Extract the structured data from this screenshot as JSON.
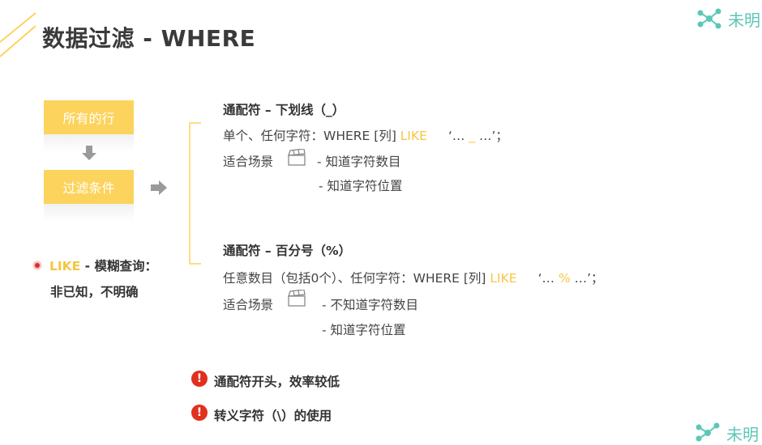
{
  "title": "数据过滤 - WHERE",
  "logo": {
    "text": "未明",
    "icon": "molecule-icon",
    "color": "#5cc7b8"
  },
  "logo_bottom": {
    "text": "未明"
  },
  "flow": {
    "box1": "所有的行",
    "box2": "过滤条件",
    "accent": "#fcd35c"
  },
  "like_note": {
    "keyword": "LIKE",
    "rest": " - 模糊查询：",
    "line2": "非已知，不明确"
  },
  "wild1": {
    "heading": "通配符 – 下划线（_）",
    "line1_prefix": "单个、任何字符：WHERE [列] ",
    "line1_kw": "LIKE",
    "line1_q1": "‘… ",
    "line1_sym": "_",
    "line1_q2": " …’；",
    "scene_label": "适合场景",
    "scene1": "- 知道字符数目",
    "scene2": "- 知道字符位置"
  },
  "wild2": {
    "heading": "通配符 – 百分号（%）",
    "line1_prefix": "任意数目（包括0个）、任何字符：WHERE [列] ",
    "line1_kw": "LIKE",
    "line1_q1": "‘… ",
    "line1_sym": "%",
    "line1_q2": " …’；",
    "scene_label": "适合场景",
    "scene1": "- 不知道字符数目",
    "scene2": "- 知道字符位置"
  },
  "warnings": [
    {
      "icon": "exclamation-icon",
      "text": "通配符开头，效率较低"
    },
    {
      "icon": "exclamation-icon",
      "text": "转义字符（\\）的使用"
    }
  ]
}
